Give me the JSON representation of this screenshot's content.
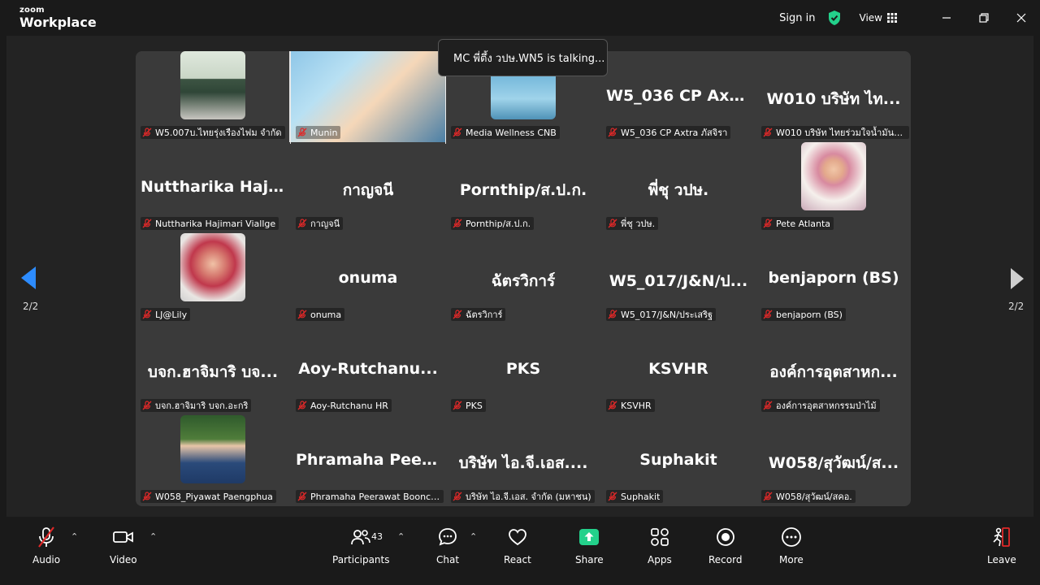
{
  "app": {
    "logo_line1": "zoom",
    "logo_line2": "Workplace"
  },
  "titlebar": {
    "signin": "Sign in",
    "view": "View"
  },
  "talking": "MC พี่ตึ้ง วปษ.WN5 is talking...",
  "pager": {
    "left": "2/2",
    "right": "2/2"
  },
  "participants": [
    {
      "big": "",
      "tag": "W5.007บ.ไทยรุ่งเรืองไฟม จำกัด",
      "photo": true
    },
    {
      "big": "",
      "tag": "Munin",
      "photo": true
    },
    {
      "big": "",
      "tag": "Media Wellness CNB",
      "photo": true
    },
    {
      "big": "W5_036 CP Axt...",
      "tag": "W5_036 CP Axtra ภัสจิรา"
    },
    {
      "big": "W010 บริษัท  ไท...",
      "tag": "W010 บริษัท  ไทยร่วมใจน้ำมันพื..."
    },
    {
      "big": "Nuttharika  Haji...",
      "tag": "Nuttharika Hajimari Viallge"
    },
    {
      "big": "กาญจนี",
      "tag": "กาญจนี"
    },
    {
      "big": "Pornthip/ส.ป.ก.",
      "tag": "Pornthip/ส.ป.ก."
    },
    {
      "big": "พี่ชุ  วปษ.",
      "tag": "พี่ชุ  วปษ."
    },
    {
      "big": "",
      "tag": "Pete Atlanta",
      "photo": true
    },
    {
      "big": "",
      "tag": "LJ@Lily",
      "photo": true
    },
    {
      "big": "onuma",
      "tag": "onuma"
    },
    {
      "big": "ฉัตรวิการ์",
      "tag": "ฉัตรวิการ์"
    },
    {
      "big": "W5_017/J&N/ป...",
      "tag": "W5_017/J&N/ประเสริฐ"
    },
    {
      "big": "benjaporn (BS)",
      "tag": "benjaporn (BS)"
    },
    {
      "big": "บจก.ฮาจิมาริ บจ...",
      "tag": "บจก.ฮาจิมาริ บจก.อะกริ"
    },
    {
      "big": "Aoy-Rutchanu...",
      "tag": "Aoy-Rutchanu HR"
    },
    {
      "big": "PKS",
      "tag": "PKS"
    },
    {
      "big": "KSVHR",
      "tag": "KSVHR"
    },
    {
      "big": "องค์การอุตสาหก...",
      "tag": "องค์การอุตสาหกรรมป่าไม้"
    },
    {
      "big": "",
      "tag": "W058_Piyawat Paengphua",
      "photo": true
    },
    {
      "big": "Phramaha  Peer...",
      "tag": "Phramaha Peerawat Boonch..."
    },
    {
      "big": "บริษัท ไอ.จี.เอส....",
      "tag": "บริษัท  ไอ.จี.เอส. จำกัด (มหาชน)"
    },
    {
      "big": "Suphakit",
      "tag": "Suphakit"
    },
    {
      "big": "W058/สุวัฒน์/ส...",
      "tag": "W058/สุวัฒน์/สคอ."
    }
  ],
  "toolbar": {
    "audio": "Audio",
    "video": "Video",
    "participants": "Participants",
    "participants_count": "43",
    "chat": "Chat",
    "react": "React",
    "share": "Share",
    "apps": "Apps",
    "record": "Record",
    "more": "More",
    "leave": "Leave"
  },
  "colors": {
    "accent": "#2d8cff",
    "share": "#23d18b",
    "muted": "#e02828",
    "leave": "#e02828"
  }
}
